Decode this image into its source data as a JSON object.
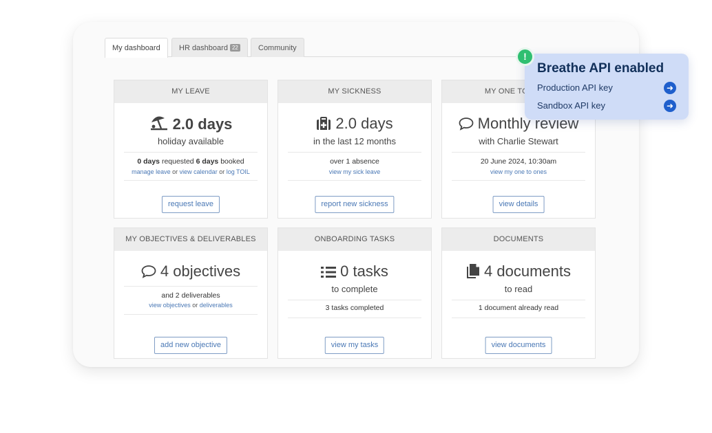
{
  "tabs": [
    {
      "label": "My dashboard",
      "active": true
    },
    {
      "label": "HR dashboard",
      "badge": "22"
    },
    {
      "label": "Community"
    }
  ],
  "cards": {
    "leave": {
      "title": "MY LEAVE",
      "icon": "beach-umbrella-icon",
      "value": "2.0 days",
      "sub": "holiday available",
      "req_num": "0 days",
      "req_text": " requested ",
      "booked_num": "6 days",
      "booked_text": " booked",
      "link1": "manage leave",
      "or1": " or ",
      "link2": "view calendar",
      "or2": " or ",
      "link3": "log TOIL",
      "button": "request leave"
    },
    "sickness": {
      "title": "MY SICKNESS",
      "icon": "medical-kit-icon",
      "value": "2.0 days",
      "sub": "in the last 12 months",
      "detail": "over 1 absence",
      "link": "view my sick leave",
      "button": "report new sickness"
    },
    "one_to_ones": {
      "title": "MY ONE TO ONES",
      "icon": "speech-bubble-icon",
      "value": "Monthly review",
      "sub": "with Charlie Stewart",
      "detail": "20 June 2024, 10:30am",
      "link": "view my one to ones",
      "button": "view details"
    },
    "objectives": {
      "title": "MY OBJECTIVES & DELIVERABLES",
      "icon": "speech-bubble-icon",
      "value": "4 objectives",
      "detail": "and 2 deliverables",
      "link1": "view objectives",
      "or": " or ",
      "link2": "deliverables",
      "button": "add new objective"
    },
    "onboarding": {
      "title": "ONBOARDING TASKS",
      "icon": "list-icon",
      "value": "0 tasks",
      "sub": "to complete",
      "detail": "3 tasks completed",
      "button": "view my tasks"
    },
    "documents": {
      "title": "DOCUMENTS",
      "icon": "documents-icon",
      "value": "4 documents",
      "sub": "to read",
      "detail": "1 document already read",
      "button": "view documents"
    }
  },
  "api_popup": {
    "title": "Breathe API enabled",
    "alert_icon": "!",
    "rows": [
      {
        "label": "Production API key",
        "icon": "arrow-right-icon"
      },
      {
        "label": "Sandbox API key",
        "icon": "arrow-right-icon"
      }
    ]
  },
  "colors": {
    "accent": "#4a78b5",
    "popup_bg": "#cfdcf7",
    "popup_title": "#12305a",
    "alert": "#2fbf71"
  }
}
